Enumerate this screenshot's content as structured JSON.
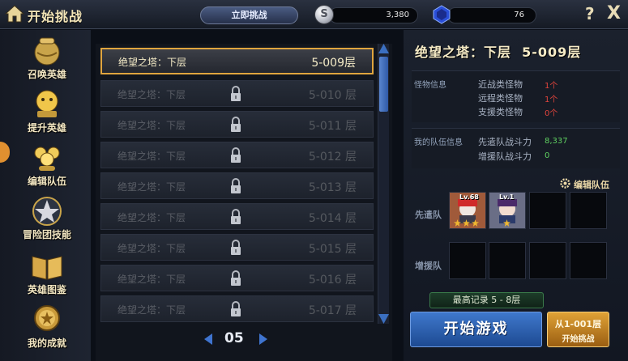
{
  "topbar": {
    "title": "开始挑战",
    "challenge_now": "立即挑战",
    "coin_value": "3,380",
    "coin_symbol": "S",
    "gem_value": "76",
    "help": "?",
    "close": "X"
  },
  "menu": [
    {
      "label": "召唤英雄",
      "icon": "summon-jar-icon"
    },
    {
      "label": "提升英雄",
      "icon": "levelup-icon"
    },
    {
      "label": "编辑队伍",
      "icon": "team-icon"
    },
    {
      "label": "冒险团技能",
      "icon": "skill-star-icon"
    },
    {
      "label": "英雄图鉴",
      "icon": "book-icon"
    },
    {
      "label": "我的成就",
      "icon": "medal-icon"
    }
  ],
  "floors": [
    {
      "name": "绝望之塔：下层",
      "num": "5-009层",
      "locked": false,
      "active": true
    },
    {
      "name": "绝望之塔：下层",
      "num": "5-010 层",
      "locked": true,
      "active": false
    },
    {
      "name": "绝望之塔：下层",
      "num": "5-011 层",
      "locked": true,
      "active": false
    },
    {
      "name": "绝望之塔：下层",
      "num": "5-012 层",
      "locked": true,
      "active": false
    },
    {
      "name": "绝望之塔：下层",
      "num": "5-013 层",
      "locked": true,
      "active": false
    },
    {
      "name": "绝望之塔：下层",
      "num": "5-014 层",
      "locked": true,
      "active": false
    },
    {
      "name": "绝望之塔：下层",
      "num": "5-015 层",
      "locked": true,
      "active": false
    },
    {
      "name": "绝望之塔：下层",
      "num": "5-016 层",
      "locked": true,
      "active": false
    },
    {
      "name": "绝望之塔：下层",
      "num": "5-017 层",
      "locked": true,
      "active": false
    }
  ],
  "pager": {
    "page": "05"
  },
  "detail": {
    "title": "绝望之塔：下层  5-009层",
    "monster_label": "怪物信息",
    "monsters": [
      {
        "label": "近战类怪物",
        "count": "1个"
      },
      {
        "label": "远程类怪物",
        "count": "1个"
      },
      {
        "label": "支援类怪物",
        "count": "0个"
      }
    ],
    "team_info_label": "我的队伍信息",
    "team_stats": [
      {
        "label": "先遣队战斗力",
        "value": "8,337"
      },
      {
        "label": "增援队战斗力",
        "value": "0"
      }
    ],
    "edit_team": "编辑队伍",
    "vanguard_label": "先遣队",
    "reinforce_label": "增援队",
    "heroes": [
      {
        "level": "Lv.68",
        "stars": 3
      },
      {
        "level": "Lv.1",
        "stars": 1
      }
    ],
    "record": "最高记录 5 - 8层",
    "start_game": "开始游戏",
    "from_first_line1": "从1-001层",
    "from_first_line2": "开始挑战"
  },
  "colors": {
    "accent_gold": "#e0a53e",
    "button_blue": "#2f5aa8",
    "count_red": "#e0443c",
    "power_green": "#5fd060"
  }
}
